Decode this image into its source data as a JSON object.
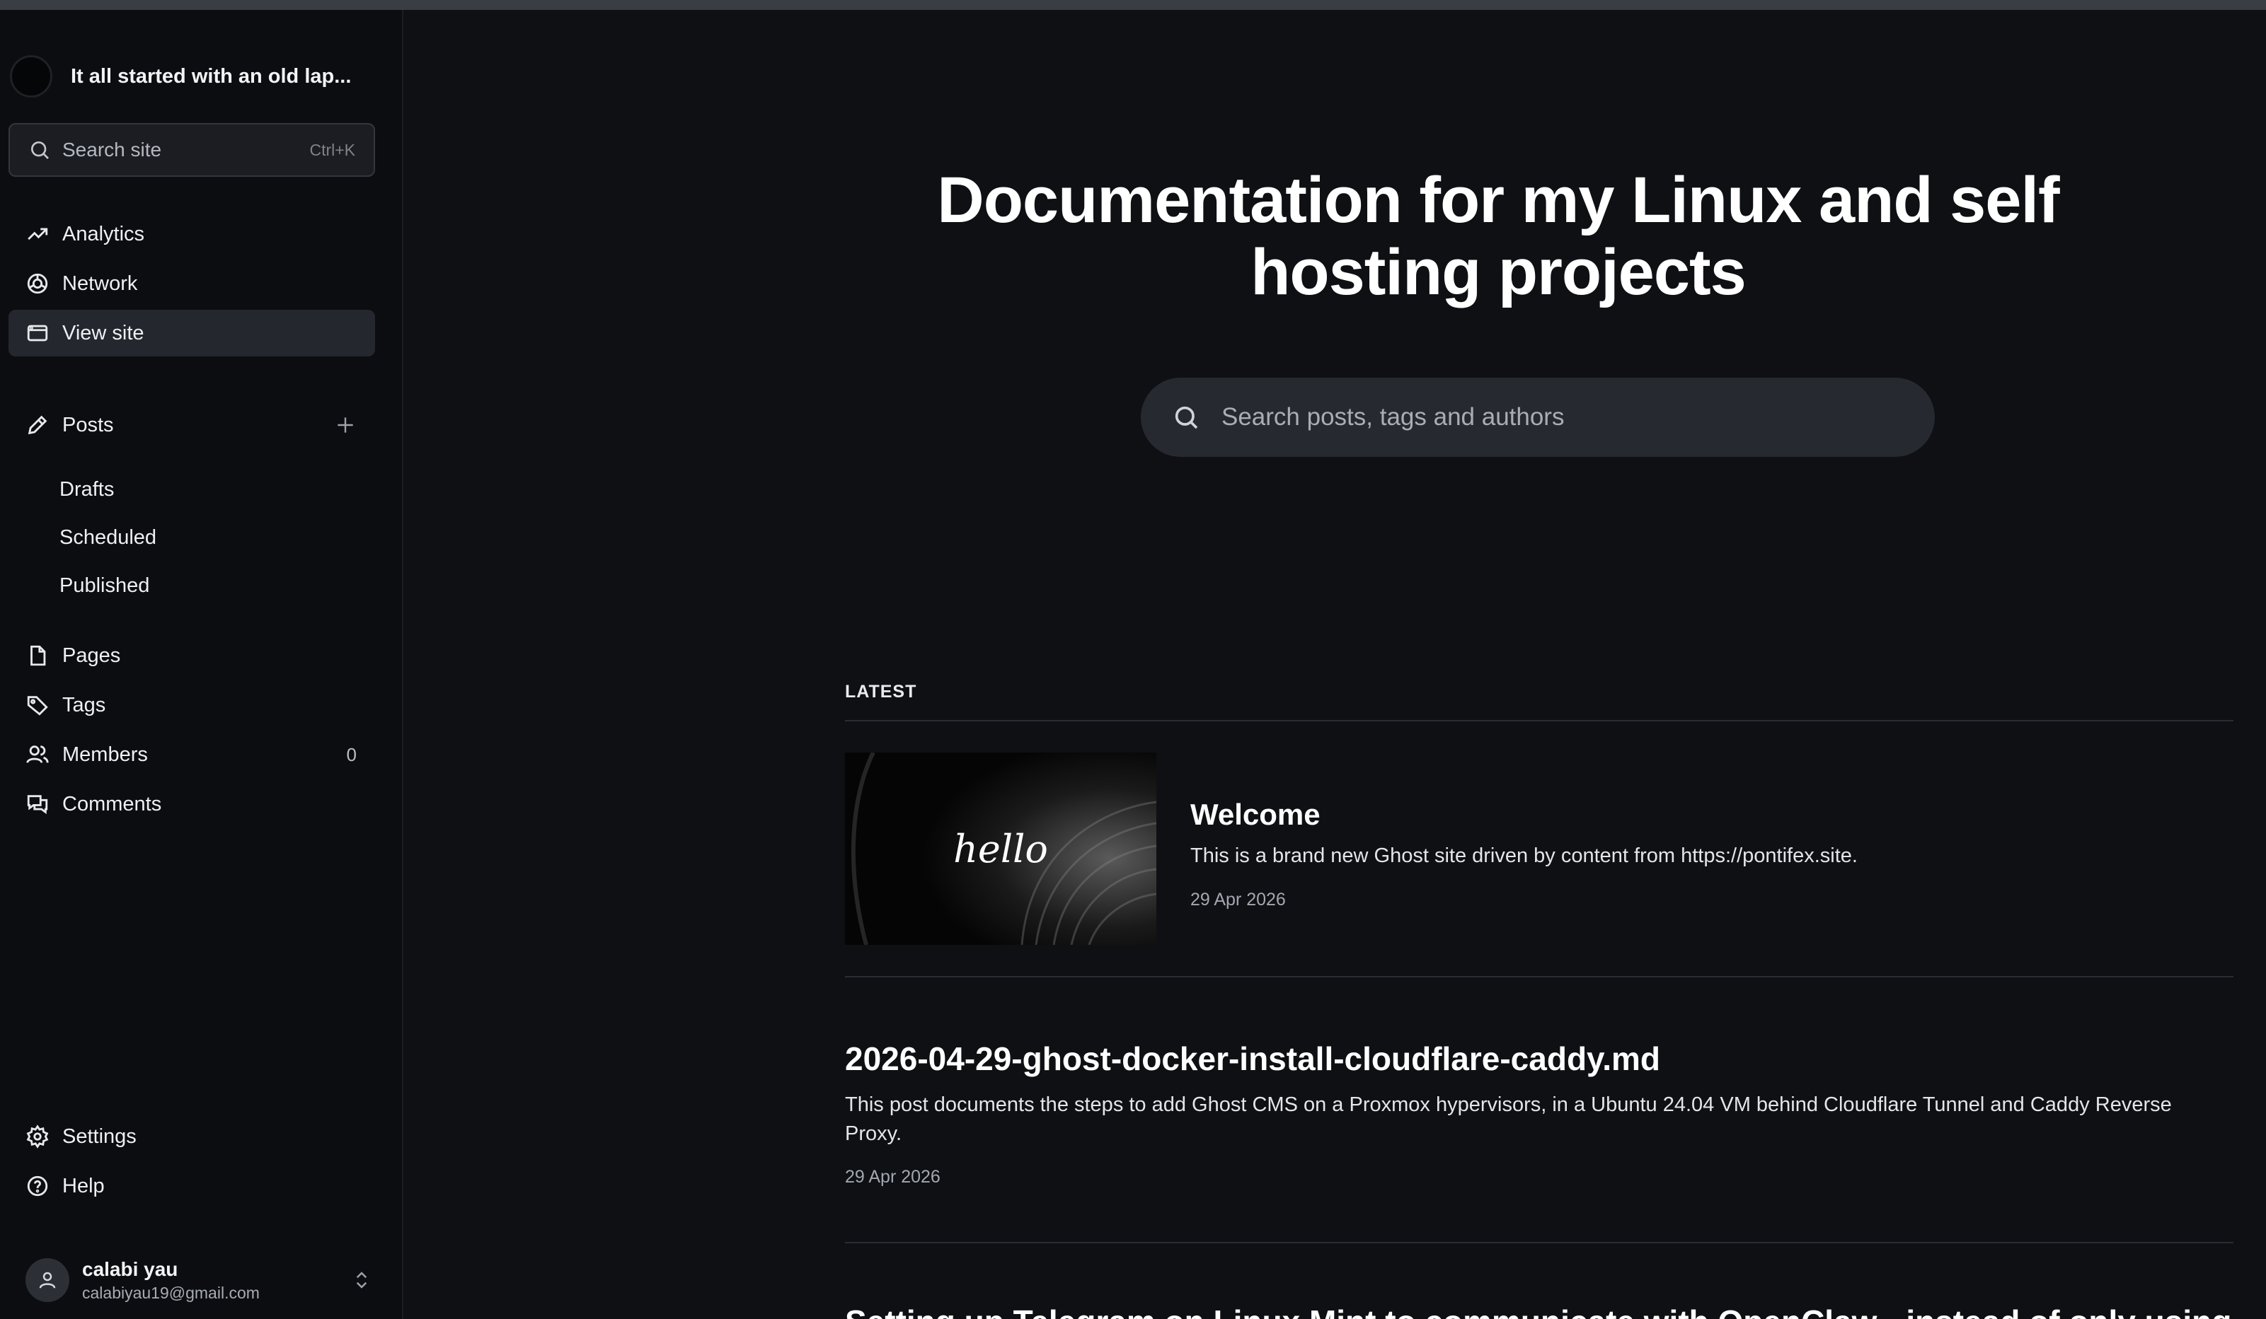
{
  "sidebar": {
    "site_title": "It all started with an old lap...",
    "search": {
      "placeholder": "Search site",
      "shortcut": "Ctrl+K"
    },
    "nav_top": [
      {
        "label": "Analytics",
        "icon": "analytics-icon"
      },
      {
        "label": "Network",
        "icon": "network-icon"
      },
      {
        "label": "View site",
        "icon": "browser-window-icon",
        "active": true
      }
    ],
    "posts": {
      "label": "Posts",
      "icon": "pencil-icon",
      "add_icon": "plus-icon",
      "sub": [
        "Drafts",
        "Scheduled",
        "Published"
      ]
    },
    "nav_mid": [
      {
        "label": "Pages",
        "icon": "page-icon"
      },
      {
        "label": "Tags",
        "icon": "tag-icon"
      },
      {
        "label": "Members",
        "icon": "members-icon",
        "count": "0"
      },
      {
        "label": "Comments",
        "icon": "comments-icon"
      }
    ],
    "nav_bottom": [
      {
        "label": "Settings",
        "icon": "gear-icon"
      },
      {
        "label": "Help",
        "icon": "help-icon"
      }
    ],
    "user": {
      "name": "calabi yau",
      "email": "calabiyau19@gmail.com"
    }
  },
  "main": {
    "hero_title": "Documentation for my Linux and self hosting projects",
    "search_placeholder": "Search posts, tags and authors",
    "section_label": "LATEST",
    "posts": [
      {
        "title": "Welcome",
        "excerpt": "This is a brand new Ghost site driven by content from https://pontifex.site.",
        "date": "29 Apr 2026",
        "thumbnail_text": "hello"
      },
      {
        "title": "2026-04-29-ghost-docker-install-cloudflare-caddy.md",
        "excerpt": "This post documents the steps to add Ghost CMS on a Proxmox hypervisors, in a Ubuntu 24.04 VM behind Cloudflare Tunnel and Caddy Reverse Proxy.",
        "date": "29 Apr 2026"
      },
      {
        "title": "Setting up Telegram on Linux Mint to communicate with OpenClaw - instead of only using"
      }
    ]
  },
  "colors": {
    "background": "#0e1014",
    "sidebar": "#0c0d10",
    "active_item": "#24272d"
  }
}
